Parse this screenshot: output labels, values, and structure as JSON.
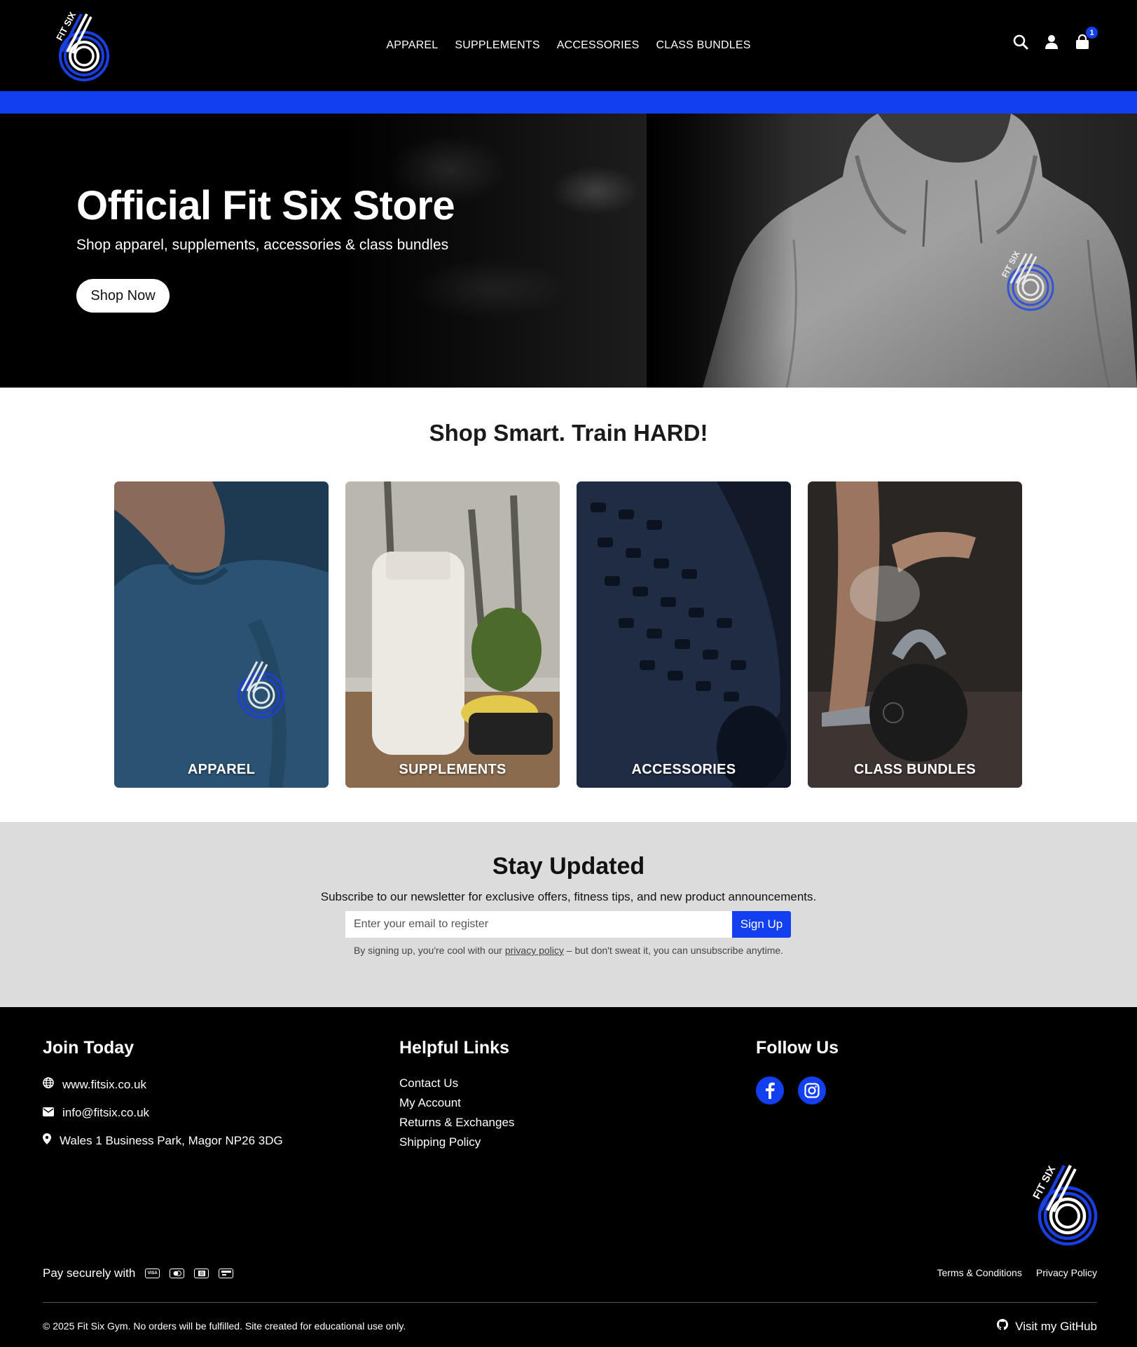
{
  "nav": {
    "items": [
      {
        "label": "APPAREL"
      },
      {
        "label": "SUPPLEMENTS"
      },
      {
        "label": "ACCESSORIES"
      },
      {
        "label": "CLASS BUNDLES"
      }
    ],
    "logo_text": "FIT SIX",
    "cart_count": "1"
  },
  "hero": {
    "title": "Official Fit Six Store",
    "subtitle": "Shop apparel, supplements, accessories & class bundles",
    "button": "Shop Now"
  },
  "categories": {
    "title": "Shop Smart. Train HARD!",
    "cards": [
      {
        "label": "APPAREL"
      },
      {
        "label": "SUPPLEMENTS"
      },
      {
        "label": "ACCESSORIES"
      },
      {
        "label": "CLASS BUNDLES"
      }
    ]
  },
  "newsletter": {
    "title": "Stay Updated",
    "description": "Subscribe to our newsletter for exclusive offers, fitness tips, and new product announcements.",
    "placeholder": "Enter your email to register",
    "button": "Sign Up",
    "note_before": "By signing up, you're cool with our ",
    "note_link": "privacy policy",
    "note_after": " – but don't sweat it, you can unsubscribe anytime."
  },
  "footer": {
    "join": {
      "title": "Join Today",
      "website": "www.fitsix.co.uk",
      "email": "info@fitsix.co.uk",
      "address": "Wales 1 Business Park, Magor NP26 3DG"
    },
    "links": {
      "title": "Helpful Links",
      "items": [
        "Contact Us",
        "My Account",
        "Returns & Exchanges",
        "Shipping Policy"
      ]
    },
    "follow": {
      "title": "Follow Us"
    },
    "pay_label": "Pay securely with",
    "legal": [
      "Terms & Conditions",
      "Privacy Policy"
    ],
    "copyright": "© 2025 Fit Six Gym. No orders will be fulfilled. Site created for educational use only.",
    "github": "Visit my GitHub"
  },
  "colors": {
    "accent": "#1240f0",
    "header_bg": "#000000",
    "newsletter_bg": "#dcdcdc"
  },
  "icons": [
    "search-icon",
    "user-icon",
    "cart-icon",
    "globe-icon",
    "envelope-icon",
    "map-pin-icon",
    "facebook-icon",
    "instagram-icon",
    "visa-icon",
    "mastercard-icon",
    "amex-icon",
    "card-icon",
    "github-icon"
  ]
}
